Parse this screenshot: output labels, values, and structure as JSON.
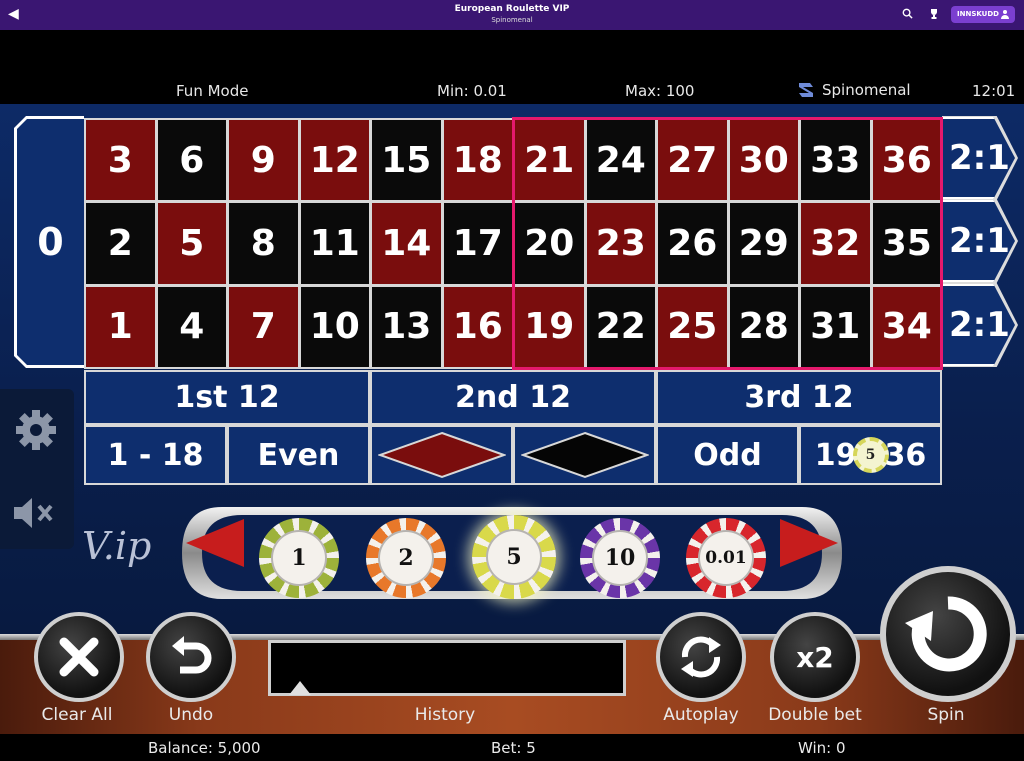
{
  "header": {
    "back_icon": "chevron-left-icon",
    "title": "European Roulette VIP",
    "subtitle": "Spinomenal",
    "login_label": "INNSKUDD"
  },
  "status": {
    "mode": "Fun Mode",
    "min": "Min: 0.01",
    "max": "Max: 100",
    "brand": "Spinomenal",
    "clock": "12:01"
  },
  "table": {
    "zero": "0",
    "columns": [
      {
        "top": {
          "n": "3",
          "c": "red"
        },
        "mid": {
          "n": "2",
          "c": "black"
        },
        "bot": {
          "n": "1",
          "c": "red"
        }
      },
      {
        "top": {
          "n": "6",
          "c": "black"
        },
        "mid": {
          "n": "5",
          "c": "red"
        },
        "bot": {
          "n": "4",
          "c": "black"
        }
      },
      {
        "top": {
          "n": "9",
          "c": "red"
        },
        "mid": {
          "n": "8",
          "c": "black"
        },
        "bot": {
          "n": "7",
          "c": "red"
        }
      },
      {
        "top": {
          "n": "12",
          "c": "red"
        },
        "mid": {
          "n": "11",
          "c": "black"
        },
        "bot": {
          "n": "10",
          "c": "black"
        }
      },
      {
        "top": {
          "n": "15",
          "c": "black"
        },
        "mid": {
          "n": "14",
          "c": "red"
        },
        "bot": {
          "n": "13",
          "c": "black"
        }
      },
      {
        "top": {
          "n": "18",
          "c": "red"
        },
        "mid": {
          "n": "17",
          "c": "black"
        },
        "bot": {
          "n": "16",
          "c": "red"
        }
      },
      {
        "top": {
          "n": "21",
          "c": "red"
        },
        "mid": {
          "n": "20",
          "c": "black"
        },
        "bot": {
          "n": "19",
          "c": "red"
        }
      },
      {
        "top": {
          "n": "24",
          "c": "black"
        },
        "mid": {
          "n": "23",
          "c": "red"
        },
        "bot": {
          "n": "22",
          "c": "black"
        }
      },
      {
        "top": {
          "n": "27",
          "c": "red"
        },
        "mid": {
          "n": "26",
          "c": "black"
        },
        "bot": {
          "n": "25",
          "c": "red"
        }
      },
      {
        "top": {
          "n": "30",
          "c": "red"
        },
        "mid": {
          "n": "29",
          "c": "black"
        },
        "bot": {
          "n": "28",
          "c": "black"
        }
      },
      {
        "top": {
          "n": "33",
          "c": "black"
        },
        "mid": {
          "n": "32",
          "c": "red"
        },
        "bot": {
          "n": "31",
          "c": "black"
        }
      },
      {
        "top": {
          "n": "36",
          "c": "red"
        },
        "mid": {
          "n": "35",
          "c": "black"
        },
        "bot": {
          "n": "34",
          "c": "red"
        }
      }
    ],
    "column_bets": [
      "2:1",
      "2:1",
      "2:1"
    ],
    "dozens": [
      "1st 12",
      "2nd 12",
      "3rd 12"
    ],
    "low": "1 - 18",
    "even": "Even",
    "odd": "Odd",
    "high_left": "19",
    "high_right": "36",
    "placed_chip": "5"
  },
  "colors": {
    "red": "#7a0d0d",
    "black": "#0a0a0a",
    "table_blue": "#0e2e6e",
    "highlight": "#e5196c"
  },
  "chips": [
    {
      "label": "1",
      "color": "#9db23a"
    },
    {
      "label": "2",
      "color": "#e8782a"
    },
    {
      "label": "5",
      "color": "#d9d94a"
    },
    {
      "label": "10",
      "color": "#6a35a8"
    },
    {
      "label": "0.01",
      "color": "#d8262c"
    }
  ],
  "vip_logo": "V.ip",
  "controls": {
    "clear_all": "Clear All",
    "undo": "Undo",
    "history": "History",
    "autoplay": "Autoplay",
    "double_bet": "Double bet",
    "double_icon_text": "x2",
    "spin": "Spin"
  },
  "footer": {
    "balance": "Balance: 5,000",
    "bet": "Bet: 5",
    "win": "Win: 0"
  }
}
